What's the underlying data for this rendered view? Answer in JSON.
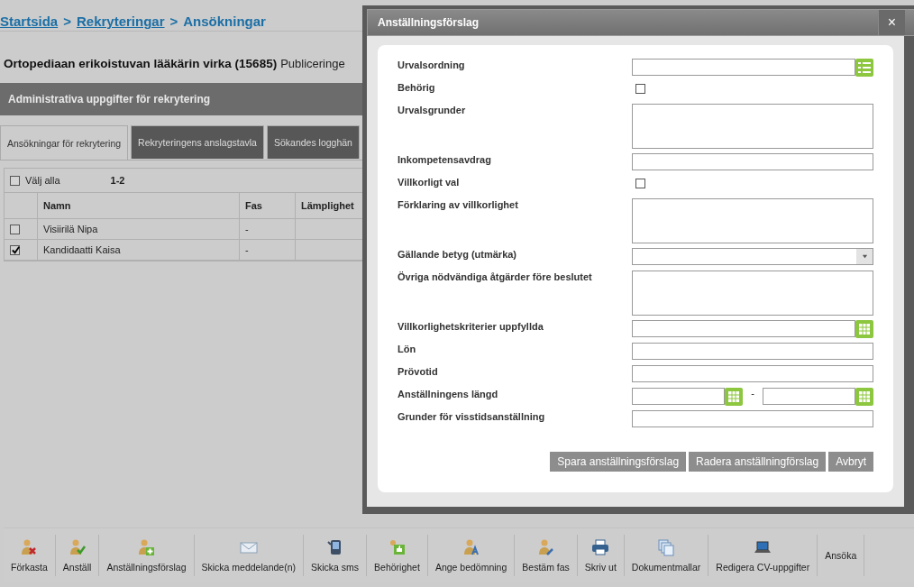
{
  "breadcrumb": [
    {
      "label": "Startsida",
      "link": true
    },
    {
      "label": "Rekryteringar",
      "link": true
    },
    {
      "label": "Ansökningar",
      "link": false
    }
  ],
  "breadcrumb_separator": ">",
  "heading": {
    "title": "Ortopediaan erikoistuvan lääkärin virka (15685)",
    "extra": "Publiceringe"
  },
  "section_bar": "Administrativa uppgifter för rekrytering",
  "tabs": [
    {
      "label": "Ansökningar för rekrytering",
      "selected": true
    },
    {
      "label": "Rekryteringens anslagstavla",
      "selected": false
    },
    {
      "label": "Sökandes logghän",
      "selected": false
    }
  ],
  "table": {
    "select_all": {
      "label": "Välj alla",
      "checked": false
    },
    "range": "1-2",
    "columns": [
      "Namn",
      "Fas",
      "Lämplighet"
    ],
    "rows": [
      {
        "checked": false,
        "name": "Visiirilä Nipa",
        "phase": "-"
      },
      {
        "checked": true,
        "name": "Kandidaatti Kaisa",
        "phase": "-"
      }
    ]
  },
  "dialog": {
    "title": "Anställningsförslag",
    "close": "×",
    "fields": [
      {
        "label": "Urvalsordning",
        "kind": "list"
      },
      {
        "label": "Behörig",
        "kind": "checkbox",
        "checked": false
      },
      {
        "label": "Urvalsgrunder",
        "kind": "textarea"
      },
      {
        "label": "Inkompetensavdrag",
        "kind": "input"
      },
      {
        "label": "Villkorligt val",
        "kind": "checkbox",
        "checked": false
      },
      {
        "label": "Förklaring av villkorlighet",
        "kind": "textarea"
      },
      {
        "label": "Gällande betyg (utmärka)",
        "kind": "select"
      },
      {
        "label": "Övriga nödvändiga åtgärder före beslutet",
        "kind": "textarea"
      },
      {
        "label": "Villkorlighetskriterier uppfyllda",
        "kind": "date"
      },
      {
        "label": "Lön",
        "kind": "input"
      },
      {
        "label": "Prövotid",
        "kind": "input"
      },
      {
        "label": "Anställningens längd",
        "kind": "daterange",
        "separator": "-"
      },
      {
        "label": "Grunder för visstidsanställning",
        "kind": "input"
      }
    ],
    "buttons": [
      "Spara anställningsförslag",
      "Radera anställningförslag",
      "Avbryt"
    ]
  },
  "toolbar": [
    "Förkasta",
    "Anställ",
    "Anställningsförslag",
    "Skicka meddelande(n)",
    "Skicka sms",
    "Behörighet",
    "Ange bedömning",
    "Bestäm fas",
    "Skriv ut",
    "Dokumentmallar",
    "Redigera CV-uppgifter",
    "Ansöka"
  ]
}
